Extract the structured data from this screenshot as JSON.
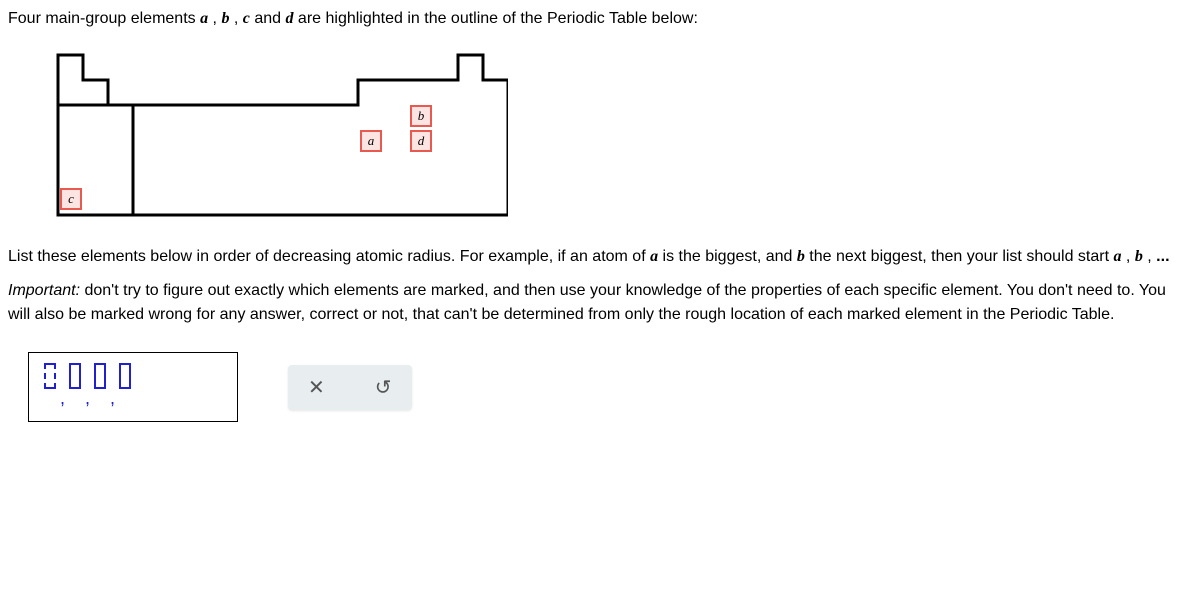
{
  "intro": {
    "prefix": "Four main-group elements ",
    "a": "a",
    "sep1": " , ",
    "b": "b",
    "sep2": " , ",
    "c": "c",
    "sep3": " and ",
    "d": "d",
    "suffix": " are highlighted in the outline of the Periodic Table below:"
  },
  "cells": {
    "a": "a",
    "b": "b",
    "c": "c",
    "d": "d"
  },
  "instruction": {
    "prefix": "List these elements below in order of decreasing atomic radius. For example, if an atom of ",
    "a": "a",
    "mid": " is the biggest, and ",
    "b": "b",
    "suffix": " the next biggest, then your list should start ",
    "example_a": "a",
    "sep1": " , ",
    "example_b": "b",
    "sep2": " , ",
    "dots": "..."
  },
  "important": {
    "label": "Important:",
    "text": " don't try to figure out exactly which elements are marked, and then use your knowledge of the properties of each specific element. You don't need to. You will also be marked wrong for any answer, correct or not, that can't be determined from only the rough location of each marked element in the Periodic Table."
  },
  "buttons": {
    "clear": "✕",
    "reset": "↺"
  }
}
